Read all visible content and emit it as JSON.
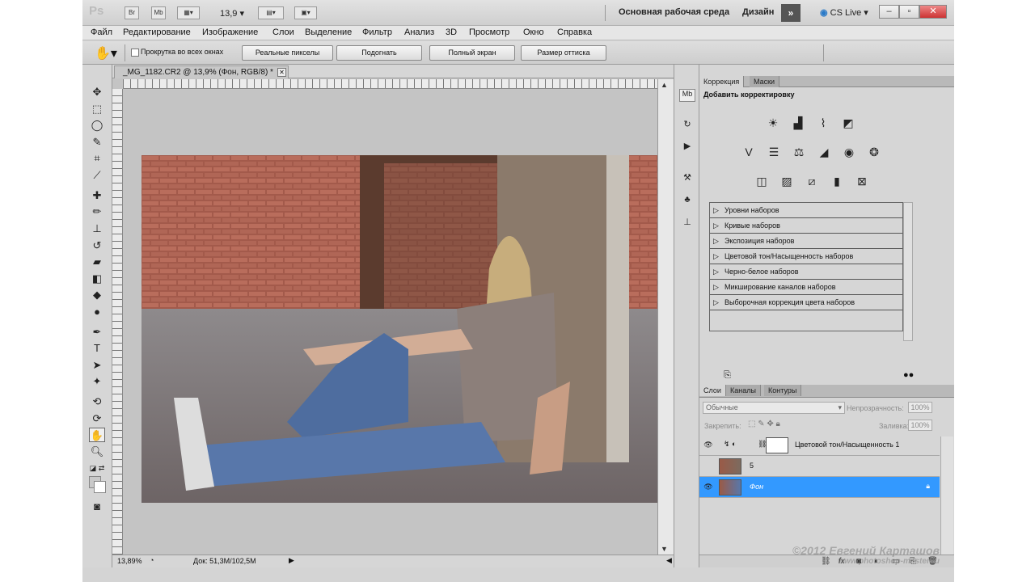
{
  "app": {
    "logo": "Ps",
    "zoom": "13,9",
    "workspace": "Основная рабочая среда",
    "design": "Дизайн",
    "cslive": "CS Live",
    "launch_br": "Br",
    "launch_mb": "Mb"
  },
  "menu": [
    "Файл",
    "Редактирование",
    "Изображение",
    "Слои",
    "Выделение",
    "Фильтр",
    "Анализ",
    "3D",
    "Просмотр",
    "Окно",
    "Справка"
  ],
  "options": {
    "scroll_all": "Прокрутка во всех окнах",
    "buttons": [
      "Реальные пикселы",
      "Подогнать",
      "Полный экран",
      "Размер оттиска"
    ]
  },
  "document": {
    "tab_title": "_MG_1182.CR2 @ 13,9% (Фон, RGB/8) *",
    "status_zoom": "13,89%",
    "status_doc": "Док: 51,3M/102,5M"
  },
  "adjustments": {
    "tabs": [
      "Коррекция",
      "Маски"
    ],
    "title": "Добавить корректировку",
    "presets": [
      "Уровни наборов",
      "Кривые наборов",
      "Экспозиция наборов",
      "Цветовой тон/Насыщенность наборов",
      "Черно-белое наборов",
      "Микширование каналов наборов",
      "Выборочная коррекция цвета наборов"
    ]
  },
  "layers": {
    "tabs": [
      "Слои",
      "Каналы",
      "Контуры"
    ],
    "blend_mode": "Обычные",
    "opacity_label": "Непрозрачность:",
    "opacity": "100%",
    "lock_label": "Закрепить:",
    "fill_label": "Заливка:",
    "fill": "100%",
    "items": [
      {
        "name": "Цветовой тон/Насыщенность 1"
      },
      {
        "name": "5"
      },
      {
        "name": "Фон"
      }
    ]
  },
  "watermark": {
    "line1": "©2012 Евгений Карташов",
    "line2": "www.photoshop-master.ru"
  }
}
